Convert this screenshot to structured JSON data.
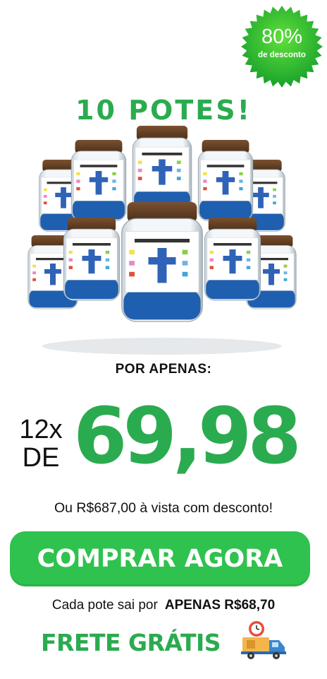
{
  "badge": {
    "percent": "80%",
    "label": "de desconto",
    "color": "#2bab4f"
  },
  "headline": "10 POTES!",
  "product": {
    "jar_label_title": "ME LEIA QUANDO ESTIVER...",
    "moods": [
      "FELIZ",
      "AGRADECIDA",
      "IRRITADA",
      "ANSIOSA",
      "SOLITÁRIA",
      "TRISTE"
    ],
    "jar_count": 10
  },
  "offer": {
    "intro": "POR APENAS:",
    "installments": "12x",
    "de": "DE",
    "price": "69,98",
    "cash_price": "Ou R$687,00 à vista com desconto!"
  },
  "cta": {
    "label": "COMPRAR AGORA",
    "color": "#2fc24e"
  },
  "per_jar": {
    "prefix": "Cada pote sai por",
    "value": "APENAS R$68,70"
  },
  "shipping": {
    "label": "FRETE GRÁTIS",
    "icon": "delivery-truck-icon"
  },
  "colors": {
    "brand_green": "#2bab4f"
  }
}
